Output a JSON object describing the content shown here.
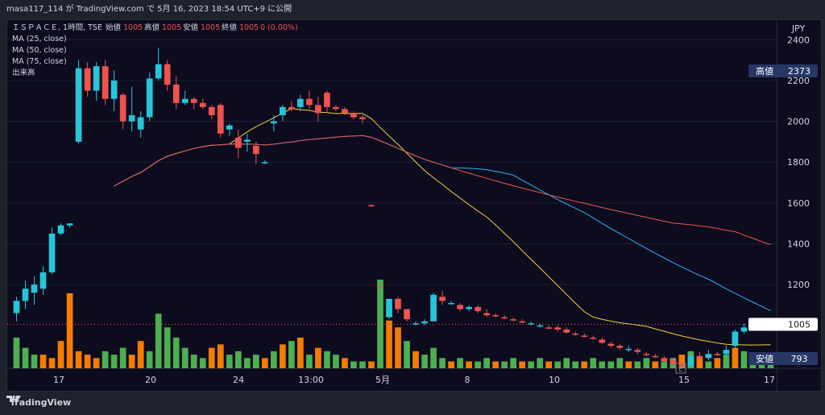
{
  "header": {
    "publish_text": "masa117_114 が TradingView.com で 5月 16, 2023 18:54 UTC+9 に公開"
  },
  "footer": {
    "brand": "TradingView"
  },
  "colors": {
    "up": "#26c6da",
    "down": "#ef5350",
    "vol_up": "#4caf50",
    "vol_down": "#f57c00",
    "ma25": "#f4d03f",
    "ma50": "#29b6f6",
    "ma75": "#ef5350",
    "badge_bg": "#263766",
    "price_badge_bg": "#ffffff"
  },
  "legend": {
    "symbol": "ＩＳＰＡＣＥ, 1時間, TSE",
    "open_label": "始値",
    "open_value": "1005",
    "high_label": "高値",
    "high_value": "1005",
    "low_label": "安値",
    "low_value": "1005",
    "close_label": "終値",
    "close_value": "1005",
    "change": "0 (0.00%)",
    "ma25": "MA (25, close)",
    "ma50": "MA (50, close)",
    "ma75": "MA (75, close)",
    "volume": "出来高"
  },
  "chart_data": {
    "type": "candlestick",
    "currency": "JPY",
    "y_ticks": [
      1200,
      1400,
      1600,
      1800,
      2000,
      2200,
      2400
    ],
    "ylim": [
      790,
      2480
    ],
    "x_ticks": [
      "17",
      "20",
      "24",
      "13:00",
      "5月",
      "8",
      "10",
      "15",
      "17"
    ],
    "high_badge": {
      "label": "高値",
      "value": "2373"
    },
    "low_badge": {
      "label": "安値",
      "value": "793"
    },
    "last_price": "1005",
    "candles": [
      [
        1060,
        1140,
        1020,
        1120
      ],
      [
        1120,
        1220,
        1080,
        1180
      ],
      [
        1160,
        1240,
        1100,
        1200
      ],
      [
        1180,
        1290,
        1150,
        1260
      ],
      [
        1260,
        1480,
        1250,
        1450
      ],
      [
        1450,
        1500,
        1440,
        1490
      ],
      [
        1490,
        1500,
        1480,
        1500
      ],
      [
        1900,
        2300,
        1890,
        2260
      ],
      [
        2260,
        2290,
        2120,
        2150
      ],
      [
        2150,
        2290,
        2100,
        2270
      ],
      [
        2270,
        2300,
        2080,
        2110
      ],
      [
        2110,
        2250,
        2050,
        2200
      ],
      [
        2130,
        2140,
        1960,
        2000
      ],
      [
        2000,
        2170,
        1950,
        2030
      ],
      [
        1960,
        2050,
        1920,
        2020
      ],
      [
        2020,
        2240,
        2000,
        2210
      ],
      [
        2210,
        2360,
        2200,
        2280
      ],
      [
        2280,
        2300,
        2150,
        2180
      ],
      [
        2180,
        2220,
        2060,
        2090
      ],
      [
        2090,
        2150,
        2080,
        2110
      ],
      [
        2110,
        2120,
        2060,
        2090
      ],
      [
        2090,
        2110,
        2060,
        2070
      ],
      [
        2070,
        2080,
        2010,
        2030
      ],
      [
        2080,
        2090,
        1920,
        1940
      ],
      [
        1960,
        1990,
        1930,
        1980
      ],
      [
        1920,
        1960,
        1820,
        1870
      ],
      [
        1900,
        1940,
        1850,
        1910
      ],
      [
        1880,
        1900,
        1790,
        1840
      ],
      [
        1800,
        1810,
        1790,
        1800
      ],
      [
        1990,
        2030,
        1950,
        2000
      ],
      [
        2030,
        2080,
        2000,
        2070
      ],
      [
        2070,
        2100,
        2050,
        2060
      ],
      [
        2070,
        2130,
        2050,
        2110
      ],
      [
        2110,
        2150,
        2060,
        2080
      ],
      [
        2080,
        2120,
        2000,
        2040
      ],
      [
        2140,
        2150,
        2040,
        2070
      ],
      [
        2070,
        2080,
        2050,
        2060
      ],
      [
        2060,
        2070,
        2030,
        2040
      ],
      [
        2040,
        2050,
        2010,
        2020
      ],
      [
        2020,
        2030,
        1990,
        2010
      ],
      [
        1590,
        1590,
        1580,
        1585
      ],
      [
        1190,
        1190,
        1180,
        1185
      ],
      [
        1040,
        1130,
        1030,
        1130
      ],
      [
        1130,
        1140,
        1060,
        1080
      ],
      [
        1080,
        1080,
        1020,
        1030
      ],
      [
        1010,
        1020,
        1000,
        1010
      ],
      [
        1010,
        1030,
        1000,
        1020
      ],
      [
        1020,
        1160,
        1020,
        1150
      ],
      [
        1140,
        1170,
        1100,
        1120
      ],
      [
        1110,
        1120,
        1100,
        1110
      ],
      [
        1100,
        1110,
        1070,
        1080
      ],
      [
        1080,
        1100,
        1070,
        1090
      ],
      [
        1090,
        1100,
        1060,
        1070
      ],
      [
        1060,
        1080,
        1040,
        1050
      ],
      [
        1050,
        1060,
        1040,
        1045
      ],
      [
        1040,
        1050,
        1030,
        1035
      ],
      [
        1030,
        1040,
        1020,
        1025
      ],
      [
        1020,
        1030,
        1010,
        1015
      ],
      [
        1010,
        1020,
        1000,
        1010
      ],
      [
        1000,
        1010,
        990,
        1000
      ],
      [
        990,
        1000,
        980,
        985
      ],
      [
        990,
        1000,
        970,
        980
      ],
      [
        980,
        990,
        960,
        965
      ],
      [
        960,
        970,
        950,
        955
      ],
      [
        950,
        960,
        940,
        945
      ],
      [
        940,
        950,
        930,
        935
      ],
      [
        930,
        940,
        910,
        915
      ],
      [
        910,
        920,
        890,
        900
      ],
      [
        900,
        910,
        880,
        890
      ],
      [
        880,
        900,
        870,
        885
      ],
      [
        880,
        890,
        860,
        870
      ],
      [
        860,
        870,
        850,
        855
      ],
      [
        850,
        860,
        840,
        845
      ],
      [
        840,
        850,
        820,
        825
      ],
      [
        830,
        840,
        800,
        810
      ],
      [
        810,
        820,
        793,
        800
      ],
      [
        800,
        860,
        795,
        850
      ],
      [
        850,
        870,
        830,
        840
      ],
      [
        840,
        880,
        830,
        860
      ],
      [
        860,
        870,
        850,
        855
      ],
      [
        860,
        900,
        850,
        880
      ],
      [
        900,
        980,
        890,
        970
      ],
      [
        970,
        1010,
        960,
        990
      ],
      [
        990,
        1010,
        980,
        1000
      ],
      [
        1000,
        1010,
        995,
        1005
      ],
      [
        1005,
        1005,
        1005,
        1005
      ]
    ],
    "volumes": [
      [
        9,
        1
      ],
      [
        6,
        1
      ],
      [
        4,
        1
      ],
      [
        4,
        0
      ],
      [
        3,
        0
      ],
      [
        8,
        0
      ],
      [
        22,
        0
      ],
      [
        5,
        0
      ],
      [
        4,
        0
      ],
      [
        3,
        0
      ],
      [
        5,
        1
      ],
      [
        4,
        1
      ],
      [
        6,
        1
      ],
      [
        4,
        0
      ],
      [
        8,
        0
      ],
      [
        5,
        1
      ],
      [
        16,
        1
      ],
      [
        12,
        1
      ],
      [
        9,
        1
      ],
      [
        6,
        1
      ],
      [
        4,
        1
      ],
      [
        3,
        1
      ],
      [
        6,
        0
      ],
      [
        7,
        0
      ],
      [
        4,
        1
      ],
      [
        5,
        1
      ],
      [
        3,
        1
      ],
      [
        4,
        1
      ],
      [
        3,
        0
      ],
      [
        5,
        1
      ],
      [
        7,
        0
      ],
      [
        8,
        1
      ],
      [
        9,
        0
      ],
      [
        4,
        1
      ],
      [
        6,
        0
      ],
      [
        5,
        1
      ],
      [
        4,
        1
      ],
      [
        3,
        0
      ],
      [
        2,
        1
      ],
      [
        2,
        1
      ],
      [
        2,
        0
      ],
      [
        26,
        1
      ],
      [
        14,
        0
      ],
      [
        12,
        0
      ],
      [
        8,
        1
      ],
      [
        5,
        0
      ],
      [
        4,
        1
      ],
      [
        6,
        1
      ],
      [
        3,
        1
      ],
      [
        2,
        0
      ],
      [
        3,
        1
      ],
      [
        2,
        0
      ],
      [
        2,
        1
      ],
      [
        3,
        1
      ],
      [
        2,
        0
      ],
      [
        2,
        1
      ],
      [
        3,
        1
      ],
      [
        2,
        0
      ],
      [
        2,
        1
      ],
      [
        3,
        1
      ],
      [
        2,
        0
      ],
      [
        2,
        1
      ],
      [
        3,
        1
      ],
      [
        2,
        1
      ],
      [
        2,
        0
      ],
      [
        3,
        1
      ],
      [
        2,
        1
      ],
      [
        2,
        1
      ],
      [
        3,
        1
      ],
      [
        2,
        0
      ],
      [
        2,
        1
      ],
      [
        3,
        1
      ],
      [
        2,
        0
      ],
      [
        2,
        1
      ],
      [
        3,
        1
      ],
      [
        4,
        0
      ],
      [
        5,
        1
      ],
      [
        3,
        0
      ],
      [
        2,
        1
      ],
      [
        3,
        0
      ],
      [
        4,
        1
      ],
      [
        6,
        0
      ],
      [
        5,
        1
      ],
      [
        3,
        1
      ],
      [
        2,
        1
      ],
      [
        2,
        1
      ]
    ]
  }
}
